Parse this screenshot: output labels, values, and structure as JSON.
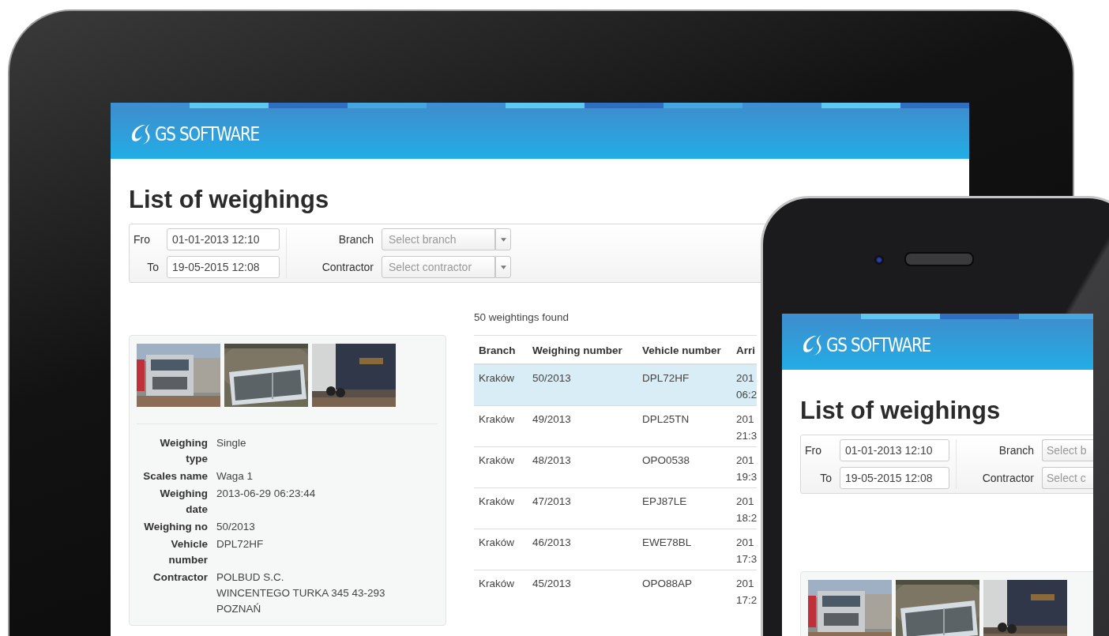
{
  "tablet": {
    "header": {
      "logo": "GS SOFTWARE"
    },
    "title": "List of weighings",
    "filters": {
      "from_label": "Fro",
      "from_value": "01-01-2013 12:10",
      "to_label": "To",
      "to_value": "19-05-2015 12:08",
      "branch_label": "Branch",
      "branch_placeholder": "Select branch",
      "contractor_label": "Contractor",
      "contractor_placeholder": "Select contractor"
    },
    "detail": {
      "fields": [
        {
          "label": "Weighing type",
          "value": "Single"
        },
        {
          "label": "Scales name",
          "value": "Waga 1"
        },
        {
          "label": "Weighing date",
          "value": "2013-06-29 06:23:44"
        },
        {
          "label": "Weighing no",
          "value": "50/2013"
        },
        {
          "label": "Vehicle number",
          "value": "DPL72HF"
        },
        {
          "label": "Contractor",
          "value": "POLBUD S.C.\nWINCENTEGO TURKA 345 43-293\nPOZNAŃ"
        }
      ]
    },
    "results": {
      "count": "50 weightings found",
      "columns": [
        "Branch",
        "Weighing number",
        "Vehicle number",
        "Arri"
      ],
      "rows": [
        {
          "branch": "Kraków",
          "weighing_number": "50/2013",
          "vehicle_number": "DPL72HF",
          "column_4": "201\n06:2",
          "selected": true
        },
        {
          "branch": "Kraków",
          "weighing_number": "49/2013",
          "vehicle_number": "DPL25TN",
          "column_4": "201\n21:3",
          "selected": false
        },
        {
          "branch": "Kraków",
          "weighing_number": "48/2013",
          "vehicle_number": "OPO0538",
          "column_4": "201\n19:3",
          "selected": false
        },
        {
          "branch": "Kraków",
          "weighing_number": "47/2013",
          "vehicle_number": "EPJ87LE",
          "column_4": "201\n18:2",
          "selected": false
        },
        {
          "branch": "Kraków",
          "weighing_number": "46/2013",
          "vehicle_number": "EWE78BL",
          "column_4": "201\n17:3",
          "selected": false
        },
        {
          "branch": "Kraków",
          "weighing_number": "45/2013",
          "vehicle_number": "OPO88AP",
          "column_4": "201\n17:2",
          "selected": false
        }
      ]
    }
  },
  "phone": {
    "header": {
      "logo": "GS SOFTWARE"
    },
    "title": "List of weighings",
    "filters": {
      "from_label": "Fro",
      "from_value": "01-01-2013 12:10",
      "to_label": "To",
      "to_value": "19-05-2015 12:08",
      "branch_label": "Branch",
      "branch_placeholder": "Select b",
      "contractor_label": "Contractor",
      "contractor_placeholder": "Select c"
    }
  }
}
